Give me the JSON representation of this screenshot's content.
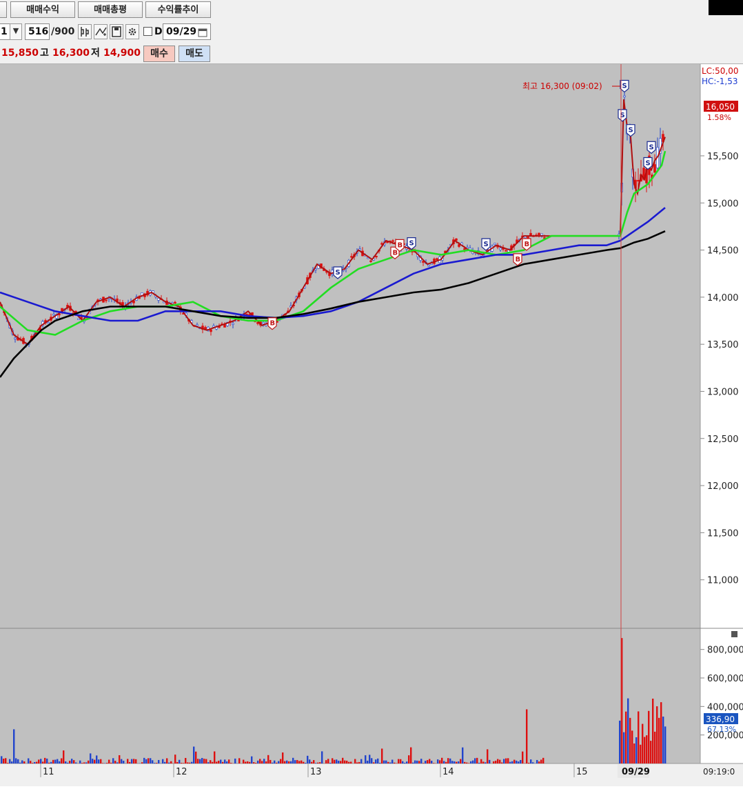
{
  "toolbar": {
    "btn_profit": "매매수익",
    "btn_summary": "매매총평",
    "btn_trend": "수익률추이"
  },
  "controls": {
    "field_left": "1",
    "count": "516",
    "count_total": "/900",
    "d_label": "D",
    "date": "09/29"
  },
  "prices": {
    "current": "15,850",
    "high_label": "고",
    "high": "16,300",
    "low_label": "저",
    "low": "14,900",
    "buy_label": "매수",
    "sell_label": "매도"
  },
  "chart": {
    "lc_label": "LC:50,00",
    "hc_label": "HC:-1,53",
    "high_annotation": "최고 16,300 (09:02)",
    "current_price_box": "16,050",
    "current_pct": "1.58%",
    "volume_box": "336,90",
    "volume_pct": "67.13%",
    "date_marker": "09/29",
    "time_label": "09:19:0"
  },
  "chart_data": {
    "type": "line",
    "price_axis": [
      "15,500",
      "15,000",
      "14,500",
      "14,000",
      "13,500",
      "13,000",
      "12,500",
      "12,000",
      "11,500",
      "11,000"
    ],
    "price_ylim": [
      10800,
      16400
    ],
    "volume_axis": [
      "800,000",
      "600,000",
      "400,000",
      "200,000"
    ],
    "x_labels": [
      "11",
      "12",
      "13",
      "14",
      "15"
    ],
    "series": [
      {
        "color": "#b01010",
        "x": [
          0,
          20,
          40,
          60,
          80,
          100,
          120,
          140,
          160,
          180,
          200,
          220,
          240,
          260,
          280,
          300,
          320,
          340,
          360,
          380,
          400,
          420,
          440,
          460,
          480,
          500,
          520,
          540,
          560,
          580,
          600,
          620,
          640,
          660,
          680,
          700,
          720,
          740,
          760,
          780,
          800,
          820,
          840,
          860,
          880,
          900,
          905,
          910,
          915,
          920,
          925,
          930,
          935,
          940,
          945,
          950,
          955,
          960,
          965
        ],
        "values": [
          13950,
          13600,
          13500,
          13700,
          13800,
          13900,
          13750,
          13950,
          14000,
          13900,
          14000,
          14050,
          13950,
          13900,
          13700,
          13650,
          13700,
          13750,
          13850,
          13700,
          13750,
          13850,
          14100,
          14350,
          14250,
          14300,
          14500,
          14400,
          14600,
          14550,
          14500,
          14350,
          14400,
          14600,
          14500,
          14450,
          14550,
          14500,
          14650,
          14650,
          14650,
          14650,
          14650,
          14650,
          14650,
          14650,
          16100,
          15800,
          15700,
          15200,
          15100,
          15300,
          15250,
          15400,
          15350,
          15450,
          15500,
          15600,
          15700
        ]
      },
      {
        "color": "#22dd22",
        "x": [
          0,
          40,
          80,
          120,
          160,
          200,
          240,
          280,
          320,
          360,
          400,
          440,
          480,
          520,
          560,
          600,
          640,
          680,
          720,
          760,
          800,
          840,
          880,
          900,
          910,
          920,
          930,
          940,
          950,
          960,
          965
        ],
        "values": [
          13900,
          13650,
          13600,
          13750,
          13850,
          13900,
          13900,
          13950,
          13800,
          13750,
          13750,
          13850,
          14100,
          14300,
          14400,
          14500,
          14450,
          14500,
          14450,
          14500,
          14650,
          14650,
          14650,
          14650,
          14900,
          15100,
          15150,
          15200,
          15300,
          15400,
          15550
        ]
      },
      {
        "color": "#1a1ad0",
        "x": [
          0,
          40,
          80,
          120,
          160,
          200,
          240,
          280,
          320,
          360,
          400,
          440,
          480,
          520,
          560,
          600,
          640,
          680,
          720,
          760,
          800,
          840,
          880,
          900,
          920,
          940,
          965
        ],
        "values": [
          14050,
          13950,
          13850,
          13800,
          13750,
          13750,
          13850,
          13850,
          13850,
          13800,
          13780,
          13800,
          13850,
          13950,
          14100,
          14250,
          14350,
          14400,
          14450,
          14450,
          14500,
          14550,
          14550,
          14600,
          14700,
          14800,
          14950
        ]
      },
      {
        "color": "#000000",
        "x": [
          0,
          20,
          40,
          60,
          80,
          120,
          160,
          200,
          240,
          280,
          320,
          360,
          400,
          440,
          480,
          520,
          560,
          600,
          640,
          680,
          720,
          760,
          800,
          840,
          880,
          900,
          920,
          940,
          965
        ],
        "values": [
          13150,
          13350,
          13500,
          13650,
          13750,
          13850,
          13900,
          13900,
          13900,
          13850,
          13800,
          13780,
          13780,
          13820,
          13880,
          13950,
          14000,
          14050,
          14080,
          14150,
          14250,
          14350,
          14400,
          14450,
          14500,
          14520,
          14580,
          14620,
          14700
        ]
      }
    ],
    "buy_sell_markers": {
      "S": [
        [
          490,
          14270
        ],
        [
          597,
          14580
        ],
        [
          705,
          14570
        ],
        [
          906,
          16250
        ],
        [
          903,
          15940
        ],
        [
          915,
          15780
        ],
        [
          940,
          15430
        ],
        [
          945,
          15600
        ]
      ],
      "B": [
        [
          395,
          13730
        ],
        [
          573,
          14480
        ],
        [
          580,
          14560
        ],
        [
          751,
          14410
        ],
        [
          764,
          14570
        ]
      ]
    },
    "volume_ylim": [
      0,
      900000
    ]
  }
}
